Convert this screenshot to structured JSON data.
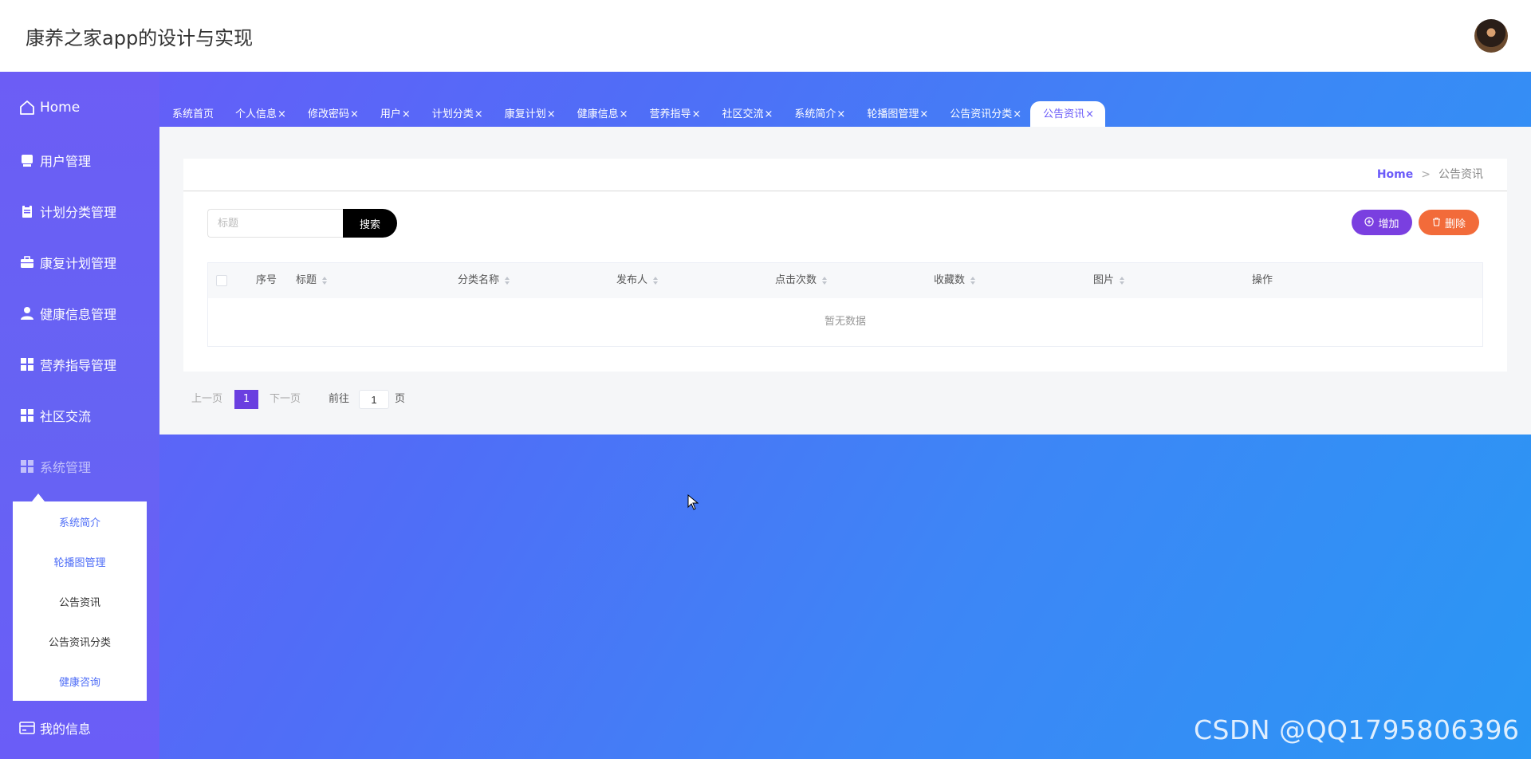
{
  "header": {
    "title": "康养之家app的设计与实现"
  },
  "sidebar": {
    "items": [
      {
        "label": "Home",
        "icon": "home-icon"
      },
      {
        "label": "用户管理",
        "icon": "user-card-icon"
      },
      {
        "label": "计划分类管理",
        "icon": "clipboard-icon"
      },
      {
        "label": "康复计划管理",
        "icon": "briefcase-icon"
      },
      {
        "label": "健康信息管理",
        "icon": "person-icon"
      },
      {
        "label": "营养指导管理",
        "icon": "grid-icon"
      },
      {
        "label": "社区交流",
        "icon": "grid-icon"
      },
      {
        "label": "系统管理",
        "icon": "grid-icon"
      },
      {
        "label": "我的信息",
        "icon": "wallet-icon"
      }
    ],
    "submenu": [
      "系统简介",
      "轮播图管理",
      "公告资讯",
      "公告资讯分类",
      "健康咨询"
    ]
  },
  "tabs": [
    {
      "label": "系统首页",
      "closable": false
    },
    {
      "label": "个人信息",
      "closable": true
    },
    {
      "label": "修改密码",
      "closable": true
    },
    {
      "label": "用户",
      "closable": true
    },
    {
      "label": "计划分类",
      "closable": true
    },
    {
      "label": "康复计划",
      "closable": true
    },
    {
      "label": "健康信息",
      "closable": true
    },
    {
      "label": "营养指导",
      "closable": true
    },
    {
      "label": "社区交流",
      "closable": true
    },
    {
      "label": "系统简介",
      "closable": true
    },
    {
      "label": "轮播图管理",
      "closable": true
    },
    {
      "label": "公告资讯分类",
      "closable": true
    },
    {
      "label": "公告资讯",
      "closable": true,
      "active": true
    }
  ],
  "tab_close": "×",
  "breadcrumb": {
    "home": "Home",
    "separator": ">",
    "current": "公告资讯"
  },
  "search": {
    "placeholder": "标题",
    "button": "搜索"
  },
  "actions": {
    "add": "增加",
    "delete": "删除"
  },
  "table": {
    "columns": [
      "序号",
      "标题",
      "分类名称",
      "发布人",
      "点击次数",
      "收藏数",
      "图片",
      "操作"
    ],
    "empty_text": "暂无数据"
  },
  "pagination": {
    "prev": "上一页",
    "current": "1",
    "next": "下一页",
    "goto_label": "前往",
    "goto_value": "1",
    "page_suffix": "页"
  },
  "watermark": "CSDN @QQ1795806396",
  "colors": {
    "accent": "#6a5af9",
    "add_button": "#7a3fe0",
    "delete_button": "#f26b3a"
  }
}
